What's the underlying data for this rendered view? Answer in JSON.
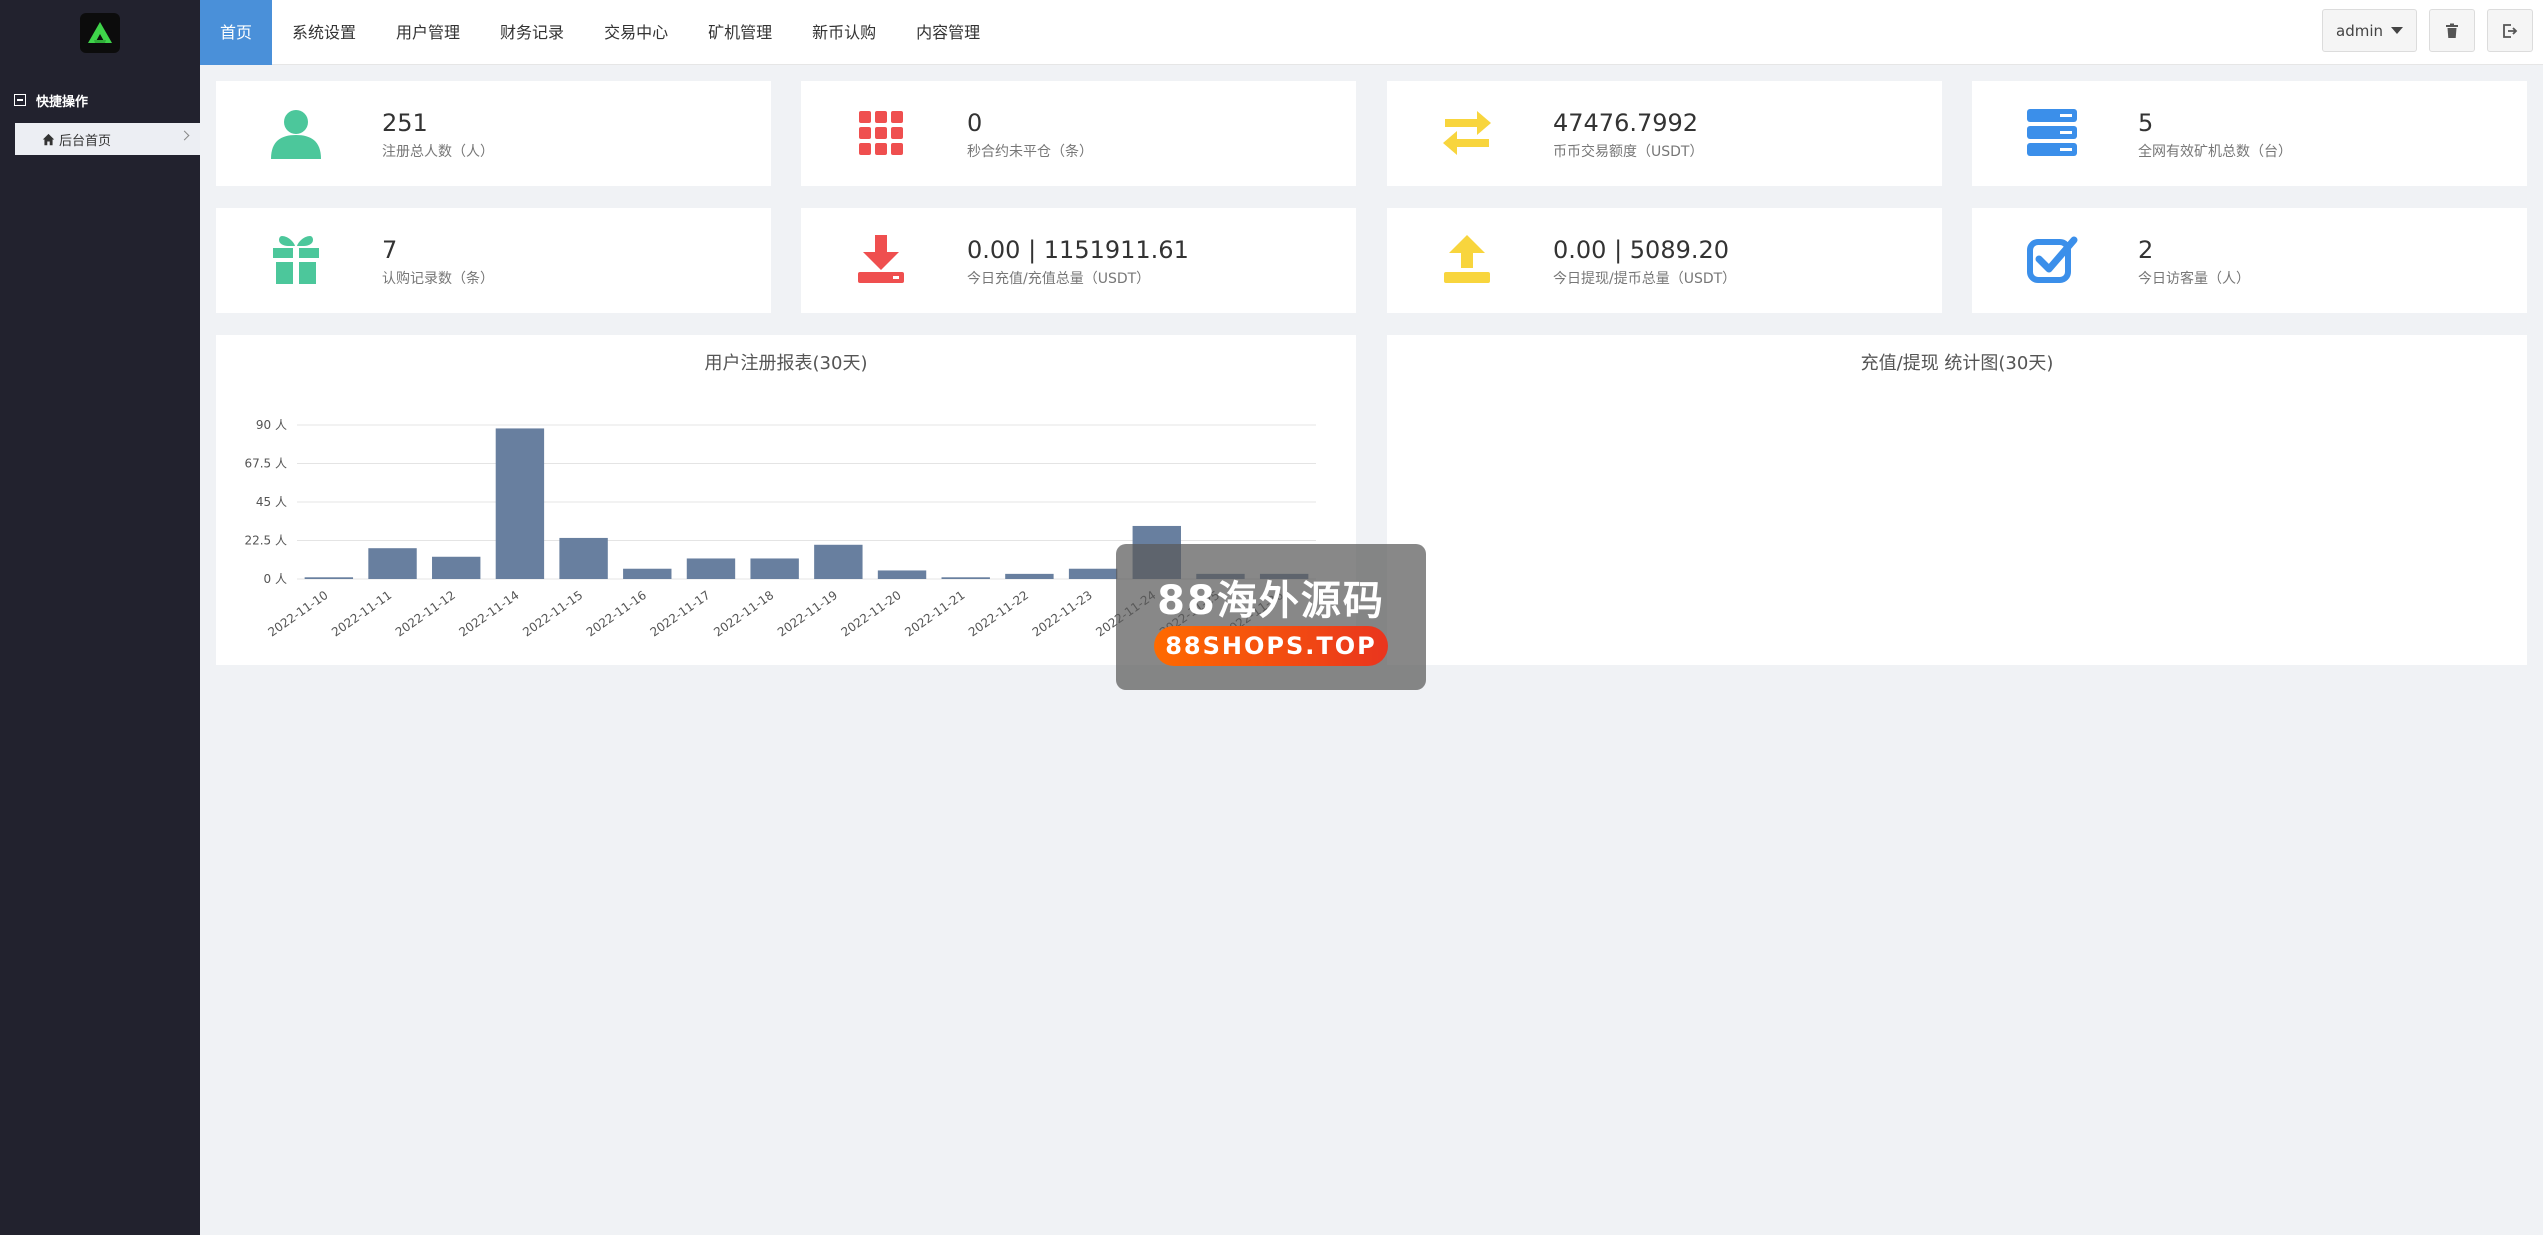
{
  "topnav": {
    "items": [
      "首页",
      "系统设置",
      "用户管理",
      "财务记录",
      "交易中心",
      "矿机管理",
      "新币认购",
      "内容管理"
    ],
    "user": "admin"
  },
  "sidebar": {
    "section_title": "快捷操作",
    "items": [
      {
        "label": "后台首页"
      }
    ]
  },
  "stats": [
    {
      "value": "251",
      "label": "注册总人数（人）",
      "icon": "user-icon",
      "color": "#4cc79b"
    },
    {
      "value": "0",
      "label": "秒合约未平仓（条）",
      "icon": "grid-icon",
      "color": "#ef4f4f"
    },
    {
      "value": "47476.7992",
      "label": "币币交易额度（USDT）",
      "icon": "exchange-arrows-icon",
      "color": "#f8d53d"
    },
    {
      "value": "5",
      "label": "全网有效矿机总数（台）",
      "icon": "server-icon",
      "color": "#3b8fea"
    },
    {
      "value": "7",
      "label": "认购记录数（条）",
      "icon": "gift-icon",
      "color": "#4cc79b"
    },
    {
      "value": "0.00 | 1151911.61",
      "label": "今日充值/充值总量（USDT）",
      "icon": "download-icon",
      "color": "#ef4f4f"
    },
    {
      "value": "0.00 | 5089.20",
      "label": "今日提现/提币总量（USDT）",
      "icon": "upload-icon",
      "color": "#f8d53d"
    },
    {
      "value": "2",
      "label": "今日访客量（人）",
      "icon": "checkbox-icon",
      "color": "#3b8fea"
    }
  ],
  "chart_data": [
    {
      "type": "bar",
      "title": "用户注册报表(30天)",
      "categories": [
        "2022-11-10",
        "2022-11-11",
        "2022-11-12",
        "2022-11-14",
        "2022-11-15",
        "2022-11-16",
        "2022-11-17",
        "2022-11-18",
        "2022-11-19",
        "2022-11-20",
        "2022-11-21",
        "2022-11-22",
        "2022-11-23",
        "2022-11-24",
        "2022-11-25",
        "2022-11-26"
      ],
      "values": [
        1,
        18,
        13,
        88,
        24,
        6,
        12,
        12,
        20,
        5,
        1,
        3,
        6,
        31,
        3,
        3
      ],
      "yticks": [
        "0 人",
        "22.5 人",
        "45 人",
        "67.5 人",
        "90 人"
      ],
      "ylim": [
        0,
        90
      ],
      "grid": true,
      "color": "#687f9f"
    },
    {
      "type": "line",
      "title": "充值/提现 统计图(30天)"
    }
  ],
  "watermark": {
    "title": "88海外源码",
    "url": "88SHOPS.TOP"
  }
}
